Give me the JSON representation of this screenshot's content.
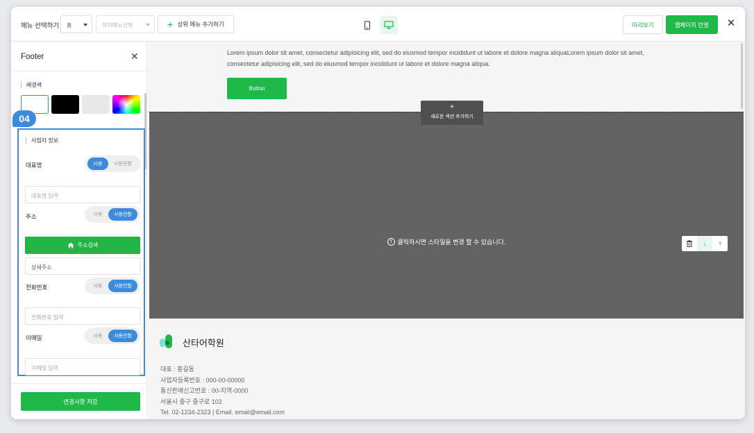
{
  "topbar": {
    "menu_select_label": "메뉴 선택하기",
    "home_select_value": "홈",
    "sub_select_placeholder": "하위메뉴선택",
    "add_menu_label": "상위 메뉴 추가하기",
    "preview_label": "미리보기",
    "apply_label": "웹페이지 반영"
  },
  "panel": {
    "title": "Footer",
    "bg_color_label": "배경색",
    "swatches": [
      "#ffffff",
      "#000000",
      "#e8e8e8",
      "spectrum"
    ],
    "badge": "04",
    "business_info_label": "사업자 정보",
    "fields": {
      "ceo": {
        "label": "대표명",
        "on": "사용",
        "off": "사용안함",
        "selected": "사용",
        "placeholder": "대표명 입력"
      },
      "address": {
        "label": "주소",
        "on": "사용",
        "off": "사용안함",
        "selected": "사용안함",
        "search_label": "주소검색",
        "detail_placeholder": "상세주소"
      },
      "phone": {
        "label": "전화번호",
        "on": "사용",
        "off": "사용안함",
        "selected": "사용안함",
        "placeholder": "전화번호 입력"
      },
      "email": {
        "label": "이메일",
        "on": "사용",
        "off": "사용안함",
        "selected": "사용안함",
        "placeholder": "이메일 입력"
      }
    },
    "save_label": "변경사항 저장"
  },
  "canvas": {
    "lorem": "Lorem ipsum dolor sit amet, consectetur adipisicing elit, sed do eiusmod tempor incididunt ut labore et dolore magna aliquaLorem ipsum dolor sit amet, consectetur adipisicing elit, sed do eiusmod tempor incididunt ut labore et dolore magna aliqua.",
    "button_label": "Button",
    "add_section_plus": "+",
    "add_section_label": "새로운 섹션 추가하기",
    "style_hint": "클릭하시면 스타일을 변경 할 수 있습니다.",
    "hint_icon": "!"
  },
  "footer": {
    "brand": "산타어학원",
    "lines": [
      "대표 : 홍길동",
      "사업자등록번호 : 000-00-00000",
      "통신판매신고번호 : 00-지역-0000",
      "서울시 중구 중구로 102",
      "Tel. 02-1234-2323 | Email. email@email.com"
    ]
  },
  "colors": {
    "accent_green": "#1fb84b",
    "highlight_blue": "#3d8bdd",
    "section_gray": "#616261"
  }
}
